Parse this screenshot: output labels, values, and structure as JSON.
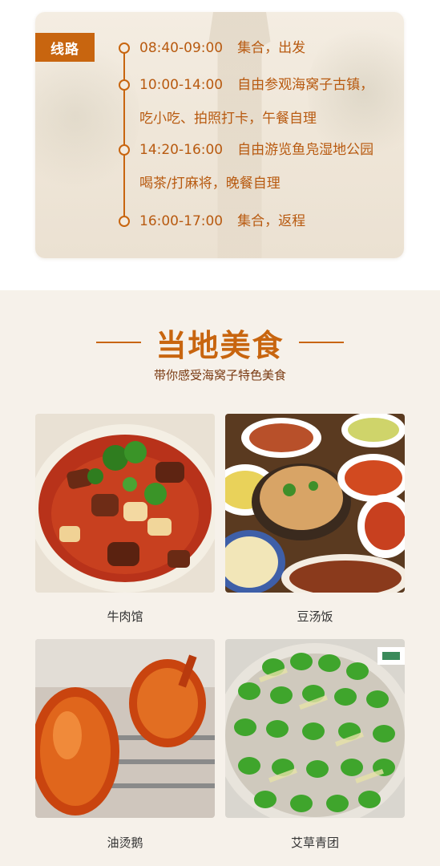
{
  "route": {
    "tag": "线路",
    "stops": [
      {
        "time": "08:40-09:00",
        "desc": "集合，出发"
      },
      {
        "time": "10:00-14:00",
        "desc": "自由参观海窝子古镇，",
        "desc2": "吃小吃、拍照打卡，午餐自理"
      },
      {
        "time": "14:20-16:00",
        "desc": "自由游览鱼凫湿地公园",
        "desc2": "喝茶/打麻将，晚餐自理"
      },
      {
        "time": "16:00-17:00",
        "desc": "集合，返程"
      }
    ]
  },
  "food": {
    "title": "当地美食",
    "subtitle": "带你感受海窝子特色美食",
    "items": [
      {
        "label": "牛肉馆",
        "icon": "beef-noodle-photo"
      },
      {
        "label": "豆汤饭",
        "icon": "bean-soup-rice-photo"
      },
      {
        "label": "油烫鹅",
        "icon": "roast-goose-photo"
      },
      {
        "label": "艾草青团",
        "icon": "mugwort-dumpling-photo"
      }
    ]
  },
  "colors": {
    "accent": "#c8650f",
    "background": "#f6f1ea"
  }
}
